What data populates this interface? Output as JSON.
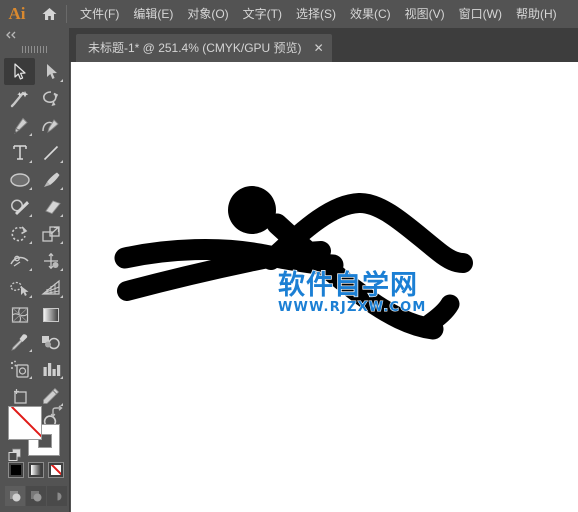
{
  "app": {
    "logo_text": "Ai",
    "home_icon": "home-icon"
  },
  "menubar": {
    "items": [
      {
        "label": "文件(F)",
        "name": "menu-file"
      },
      {
        "label": "编辑(E)",
        "name": "menu-edit"
      },
      {
        "label": "对象(O)",
        "name": "menu-object"
      },
      {
        "label": "文字(T)",
        "name": "menu-type"
      },
      {
        "label": "选择(S)",
        "name": "menu-select"
      },
      {
        "label": "效果(C)",
        "name": "menu-effect"
      },
      {
        "label": "视图(V)",
        "name": "menu-view"
      },
      {
        "label": "窗口(W)",
        "name": "menu-window"
      },
      {
        "label": "帮助(H)",
        "name": "menu-help"
      }
    ]
  },
  "document_tab": {
    "title": "未标题-1* @ 251.4% (CMYK/GPU 预览)",
    "close_label": "✕",
    "zoom_level": "251.4%",
    "color_mode": "CMYK",
    "preview_mode": "GPU 预览",
    "modified": true
  },
  "toolpanel": {
    "collapse_label": "◀◀",
    "tools": [
      {
        "name": "selection-tool",
        "active": true,
        "has_flyout": false
      },
      {
        "name": "direct-selection-tool",
        "active": false,
        "has_flyout": true
      },
      {
        "name": "magic-wand-tool",
        "active": false,
        "has_flyout": false
      },
      {
        "name": "lasso-tool",
        "active": false,
        "has_flyout": false
      },
      {
        "name": "pen-tool",
        "active": false,
        "has_flyout": true
      },
      {
        "name": "curvature-tool",
        "active": false,
        "has_flyout": false
      },
      {
        "name": "type-tool",
        "active": false,
        "has_flyout": true
      },
      {
        "name": "line-segment-tool",
        "active": false,
        "has_flyout": true
      },
      {
        "name": "ellipse-tool",
        "active": false,
        "has_flyout": true
      },
      {
        "name": "paintbrush-tool",
        "active": false,
        "has_flyout": true
      },
      {
        "name": "shaper-pencil-tool",
        "active": false,
        "has_flyout": true
      },
      {
        "name": "eraser-tool",
        "active": false,
        "has_flyout": true
      },
      {
        "name": "rotate-tool",
        "active": false,
        "has_flyout": true
      },
      {
        "name": "scale-tool",
        "active": false,
        "has_flyout": true
      },
      {
        "name": "width-tool",
        "active": false,
        "has_flyout": true
      },
      {
        "name": "free-transform-tool",
        "active": false,
        "has_flyout": true
      },
      {
        "name": "shape-builder-tool",
        "active": false,
        "has_flyout": true
      },
      {
        "name": "perspective-grid-tool",
        "active": false,
        "has_flyout": true
      },
      {
        "name": "mesh-tool",
        "active": false,
        "has_flyout": false
      },
      {
        "name": "gradient-tool",
        "active": false,
        "has_flyout": false
      },
      {
        "name": "eyedropper-tool",
        "active": false,
        "has_flyout": true
      },
      {
        "name": "blend-tool",
        "active": false,
        "has_flyout": false
      },
      {
        "name": "symbol-sprayer-tool",
        "active": false,
        "has_flyout": true
      },
      {
        "name": "column-graph-tool",
        "active": false,
        "has_flyout": true
      },
      {
        "name": "artboard-tool",
        "active": false,
        "has_flyout": false
      },
      {
        "name": "slice-tool",
        "active": false,
        "has_flyout": true
      },
      {
        "name": "hand-tool",
        "active": false,
        "has_flyout": true
      },
      {
        "name": "zoom-tool",
        "active": false,
        "has_flyout": false
      }
    ],
    "color_controls": {
      "fill": "none",
      "fill_color": "#ffffff",
      "stroke": "white",
      "stroke_color": "#ffffff",
      "swap_icon": "swap-fill-stroke-icon",
      "default_icon": "default-fill-stroke-icon",
      "modes": [
        {
          "name": "color-mode-button",
          "label": "color"
        },
        {
          "name": "gradient-mode-button",
          "label": "gradient"
        },
        {
          "name": "none-mode-button",
          "label": "none"
        }
      ],
      "draw_modes": [
        {
          "name": "draw-normal-button",
          "selected": true
        },
        {
          "name": "draw-behind-button",
          "selected": false
        },
        {
          "name": "draw-inside-button",
          "selected": false
        }
      ]
    }
  },
  "canvas": {
    "background_color": "#ffffff",
    "artwork_name": "stick-figure-swimmer-drawing",
    "artwork_color": "#000000",
    "watermark": {
      "chinese_text": "软件自学网",
      "url_text": "WWW.RJZXW.COM",
      "color": "#1b7fd4"
    }
  }
}
